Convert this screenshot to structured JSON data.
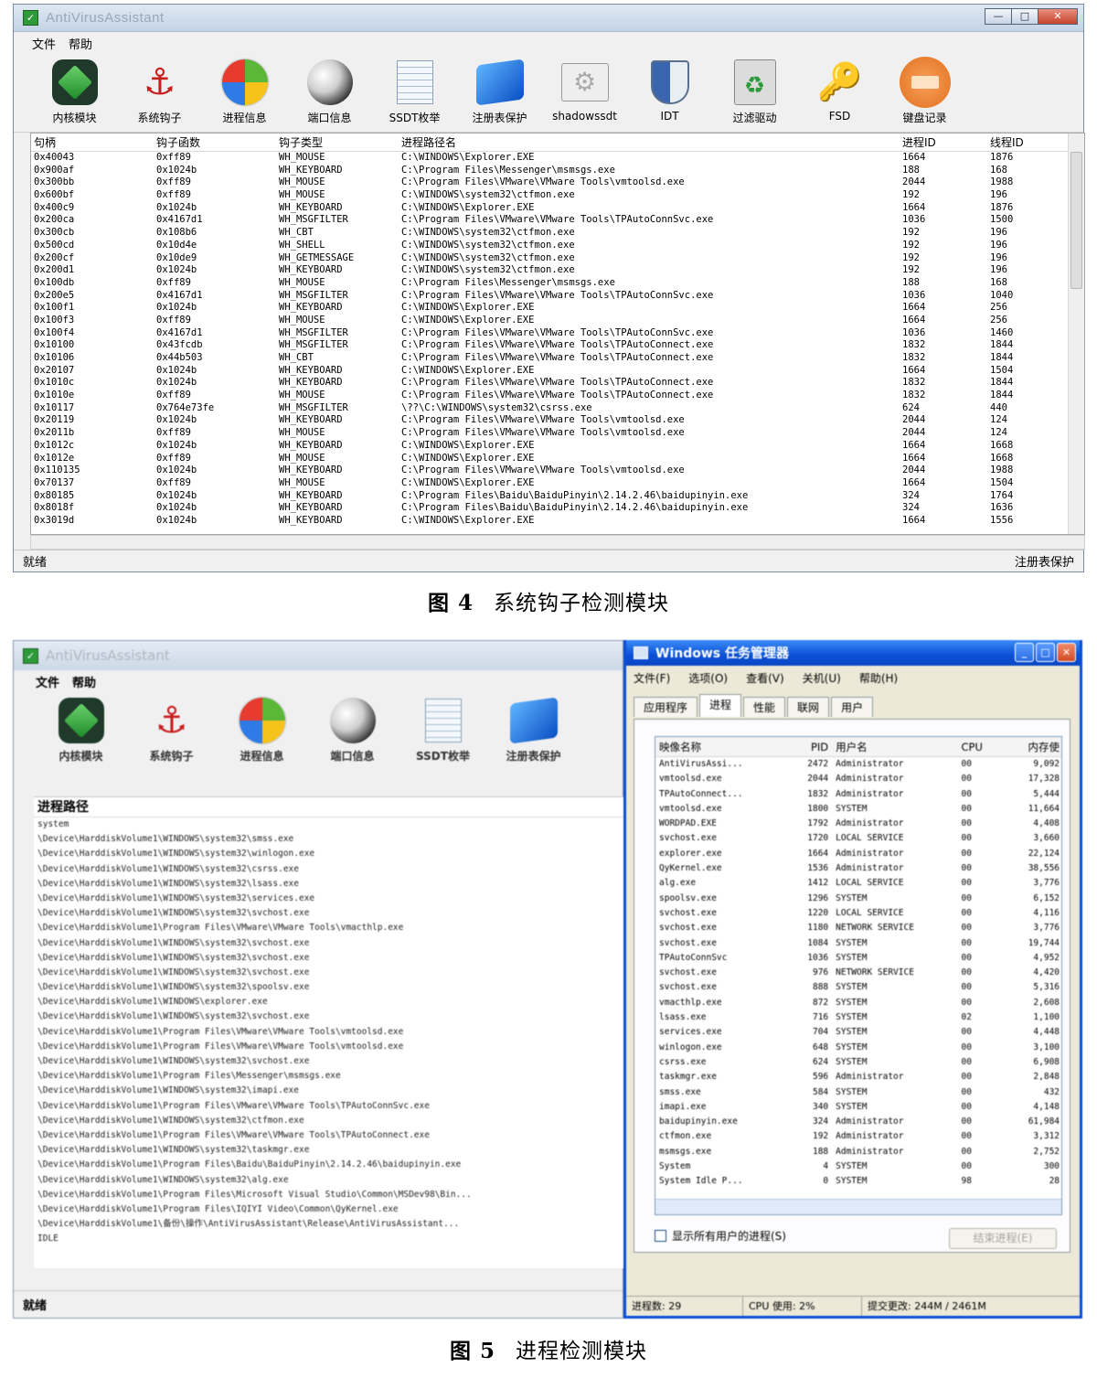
{
  "fig4": {
    "window_title": "AntiVirusAssistant",
    "menu": [
      "文件",
      "帮助"
    ],
    "toolbar": [
      {
        "label": "内核模块",
        "icon": "kernel-cube-icon"
      },
      {
        "label": "系统钩子",
        "icon": "anchor-icon"
      },
      {
        "label": "进程信息",
        "icon": "windows-logo-icon"
      },
      {
        "label": "端口信息",
        "icon": "globe-icon"
      },
      {
        "label": "SSDT枚举",
        "icon": "table-icon"
      },
      {
        "label": "注册表保护",
        "icon": "registry-icon"
      },
      {
        "label": "shadowssdt",
        "icon": "gear-window-icon"
      },
      {
        "label": "IDT",
        "icon": "shield-icon"
      },
      {
        "label": "过滤驱动",
        "icon": "recycle-icon"
      },
      {
        "label": "FSD",
        "icon": "key-icon"
      },
      {
        "label": "键盘记录",
        "icon": "keyboard-icon"
      }
    ],
    "columns": [
      "句柄",
      "钩子函数",
      "钩子类型",
      "进程路径名",
      "进程ID",
      "线程ID"
    ],
    "rows": [
      [
        "0x40043",
        "0xff89",
        "WH_MOUSE",
        "C:\\WINDOWS\\Explorer.EXE",
        "1664",
        "1876"
      ],
      [
        "0x900af",
        "0x1024b",
        "WH_KEYBOARD",
        "C:\\Program Files\\Messenger\\msmsgs.exe",
        "188",
        "168"
      ],
      [
        "0x300bb",
        "0xff89",
        "WH_MOUSE",
        "C:\\Program Files\\VMware\\VMware Tools\\vmtoolsd.exe",
        "2044",
        "1988"
      ],
      [
        "0x600bf",
        "0xff89",
        "WH_MOUSE",
        "C:\\WINDOWS\\system32\\ctfmon.exe",
        "192",
        "196"
      ],
      [
        "0x400c9",
        "0x1024b",
        "WH_KEYBOARD",
        "C:\\WINDOWS\\Explorer.EXE",
        "1664",
        "1876"
      ],
      [
        "0x200ca",
        "0x4167d1",
        "WH_MSGFILTER",
        "C:\\Program Files\\VMware\\VMware Tools\\TPAutoConnSvc.exe",
        "1036",
        "1500"
      ],
      [
        "0x300cb",
        "0x108b6",
        "WH_CBT",
        "C:\\WINDOWS\\system32\\ctfmon.exe",
        "192",
        "196"
      ],
      [
        "0x500cd",
        "0x10d4e",
        "WH_SHELL",
        "C:\\WINDOWS\\system32\\ctfmon.exe",
        "192",
        "196"
      ],
      [
        "0x200cf",
        "0x10de9",
        "WH_GETMESSAGE",
        "C:\\WINDOWS\\system32\\ctfmon.exe",
        "192",
        "196"
      ],
      [
        "0x200d1",
        "0x1024b",
        "WH_KEYBOARD",
        "C:\\WINDOWS\\system32\\ctfmon.exe",
        "192",
        "196"
      ],
      [
        "0x100db",
        "0xff89",
        "WH_MOUSE",
        "C:\\Program Files\\Messenger\\msmsgs.exe",
        "188",
        "168"
      ],
      [
        "0x200e5",
        "0x4167d1",
        "WH_MSGFILTER",
        "C:\\Program Files\\VMware\\VMware Tools\\TPAutoConnSvc.exe",
        "1036",
        "1040"
      ],
      [
        "0x100f1",
        "0x1024b",
        "WH_KEYBOARD",
        "C:\\WINDOWS\\Explorer.EXE",
        "1664",
        "256"
      ],
      [
        "0x100f3",
        "0xff89",
        "WH_MOUSE",
        "C:\\WINDOWS\\Explorer.EXE",
        "1664",
        "256"
      ],
      [
        "0x100f4",
        "0x4167d1",
        "WH_MSGFILTER",
        "C:\\Program Files\\VMware\\VMware Tools\\TPAutoConnSvc.exe",
        "1036",
        "1460"
      ],
      [
        "0x10100",
        "0x43fcdb",
        "WH_MSGFILTER",
        "C:\\Program Files\\VMware\\VMware Tools\\TPAutoConnect.exe",
        "1832",
        "1844"
      ],
      [
        "0x10106",
        "0x44b503",
        "WH_CBT",
        "C:\\Program Files\\VMware\\VMware Tools\\TPAutoConnect.exe",
        "1832",
        "1844"
      ],
      [
        "0x20107",
        "0x1024b",
        "WH_KEYBOARD",
        "C:\\WINDOWS\\Explorer.EXE",
        "1664",
        "1504"
      ],
      [
        "0x1010c",
        "0x1024b",
        "WH_KEYBOARD",
        "C:\\Program Files\\VMware\\VMware Tools\\TPAutoConnect.exe",
        "1832",
        "1844"
      ],
      [
        "0x1010e",
        "0xff89",
        "WH_MOUSE",
        "C:\\Program Files\\VMware\\VMware Tools\\TPAutoConnect.exe",
        "1832",
        "1844"
      ],
      [
        "0x10117",
        "0x764e73fe",
        "WH_MSGFILTER",
        "\\??\\C:\\WINDOWS\\system32\\csrss.exe",
        "624",
        "440"
      ],
      [
        "0x20119",
        "0x1024b",
        "WH_KEYBOARD",
        "C:\\Program Files\\VMware\\VMware Tools\\vmtoolsd.exe",
        "2044",
        "124"
      ],
      [
        "0x2011b",
        "0xff89",
        "WH_MOUSE",
        "C:\\Program Files\\VMware\\VMware Tools\\vmtoolsd.exe",
        "2044",
        "124"
      ],
      [
        "0x1012c",
        "0x1024b",
        "WH_KEYBOARD",
        "C:\\WINDOWS\\Explorer.EXE",
        "1664",
        "1668"
      ],
      [
        "0x1012e",
        "0xff89",
        "WH_MOUSE",
        "C:\\WINDOWS\\Explorer.EXE",
        "1664",
        "1668"
      ],
      [
        "0x110135",
        "0x1024b",
        "WH_KEYBOARD",
        "C:\\Program Files\\VMware\\VMware Tools\\vmtoolsd.exe",
        "2044",
        "1988"
      ],
      [
        "0x70137",
        "0xff89",
        "WH_MOUSE",
        "C:\\WINDOWS\\Explorer.EXE",
        "1664",
        "1504"
      ],
      [
        "0x80185",
        "0x1024b",
        "WH_KEYBOARD",
        "C:\\Program Files\\Baidu\\BaiduPinyin\\2.14.2.46\\baidupinyin.exe",
        "324",
        "1764"
      ],
      [
        "0x8018f",
        "0x1024b",
        "WH_KEYBOARD",
        "C:\\Program Files\\Baidu\\BaiduPinyin\\2.14.2.46\\baidupinyin.exe",
        "324",
        "1636"
      ],
      [
        "0x3019d",
        "0x1024b",
        "WH_KEYBOARD",
        "C:\\WINDOWS\\Explorer.EXE",
        "1664",
        "1556"
      ]
    ],
    "status_left": "就绪",
    "status_right": "注册表保护",
    "caption_num": "图 4",
    "caption_text": "系统钩子检测模块"
  },
  "fig5": {
    "left": {
      "window_title": "AntiVirusAssistant",
      "menu": [
        "文件",
        "帮助"
      ],
      "toolbar": [
        {
          "label": "内核模块",
          "icon": "kernel-cube-icon"
        },
        {
          "label": "系统钩子",
          "icon": "anchor-icon"
        },
        {
          "label": "进程信息",
          "icon": "windows-logo-icon"
        },
        {
          "label": "端口信息",
          "icon": "globe-icon"
        },
        {
          "label": "SSDT枚举",
          "icon": "table-icon"
        },
        {
          "label": "注册表保护",
          "icon": "registry-icon"
        }
      ],
      "list_header": "进程路径",
      "paths": [
        "system",
        "\\Device\\HarddiskVolume1\\WINDOWS\\system32\\smss.exe",
        "\\Device\\HarddiskVolume1\\WINDOWS\\system32\\winlogon.exe",
        "\\Device\\HarddiskVolume1\\WINDOWS\\system32\\csrss.exe",
        "\\Device\\HarddiskVolume1\\WINDOWS\\system32\\lsass.exe",
        "\\Device\\HarddiskVolume1\\WINDOWS\\system32\\services.exe",
        "\\Device\\HarddiskVolume1\\WINDOWS\\system32\\svchost.exe",
        "\\Device\\HarddiskVolume1\\Program Files\\VMware\\VMware Tools\\vmacthlp.exe",
        "\\Device\\HarddiskVolume1\\WINDOWS\\system32\\svchost.exe",
        "\\Device\\HarddiskVolume1\\WINDOWS\\system32\\svchost.exe",
        "\\Device\\HarddiskVolume1\\WINDOWS\\system32\\svchost.exe",
        "\\Device\\HarddiskVolume1\\WINDOWS\\system32\\spoolsv.exe",
        "\\Device\\HarddiskVolume1\\WINDOWS\\explorer.exe",
        "\\Device\\HarddiskVolume1\\WINDOWS\\system32\\svchost.exe",
        "\\Device\\HarddiskVolume1\\Program Files\\VMware\\VMware Tools\\vmtoolsd.exe",
        "\\Device\\HarddiskVolume1\\Program Files\\VMware\\VMware Tools\\vmtoolsd.exe",
        "\\Device\\HarddiskVolume1\\WINDOWS\\system32\\svchost.exe",
        "\\Device\\HarddiskVolume1\\Program Files\\Messenger\\msmsgs.exe",
        "\\Device\\HarddiskVolume1\\WINDOWS\\system32\\imapi.exe",
        "\\Device\\HarddiskVolume1\\Program Files\\VMware\\VMware Tools\\TPAutoConnSvc.exe",
        "\\Device\\HarddiskVolume1\\WINDOWS\\system32\\ctfmon.exe",
        "\\Device\\HarddiskVolume1\\Program Files\\VMware\\VMware Tools\\TPAutoConnect.exe",
        "\\Device\\HarddiskVolume1\\WINDOWS\\system32\\taskmgr.exe",
        "\\Device\\HarddiskVolume1\\Program Files\\Baidu\\BaiduPinyin\\2.14.2.46\\baidupinyin.exe",
        "\\Device\\HarddiskVolume1\\WINDOWS\\system32\\alg.exe",
        "\\Device\\HarddiskVolume1\\Program Files\\Microsoft Visual Studio\\Common\\MSDev98\\Bin...",
        "\\Device\\HarddiskVolume1\\Program Files\\IQIYI Video\\Common\\QyKernel.exe",
        "\\Device\\HarddiskVolume1\\备份\\操作\\AntiVirusAssistant\\Release\\AntiVirusAssistant...",
        "IDLE"
      ],
      "status": "就绪"
    },
    "right": {
      "window_title": "Windows 任务管理器",
      "menu": [
        "文件(F)",
        "选项(O)",
        "查看(V)",
        "关机(U)",
        "帮助(H)"
      ],
      "tabs": [
        "应用程序",
        "进程",
        "性能",
        "联网",
        "用户"
      ],
      "active_tab": "进程",
      "columns": [
        "映像名称",
        "PID",
        "用户名",
        "CPU",
        "内存使"
      ],
      "rows": [
        [
          "AntiVirusAssi...",
          "2472",
          "Administrator",
          "00",
          "9,092"
        ],
        [
          "vmtoolsd.exe",
          "2044",
          "Administrator",
          "00",
          "17,328"
        ],
        [
          "TPAutoConnect...",
          "1832",
          "Administrator",
          "00",
          "5,444"
        ],
        [
          "vmtoolsd.exe",
          "1800",
          "SYSTEM",
          "00",
          "11,664"
        ],
        [
          "WORDPAD.EXE",
          "1792",
          "Administrator",
          "00",
          "4,408"
        ],
        [
          "svchost.exe",
          "1720",
          "LOCAL SERVICE",
          "00",
          "3,660"
        ],
        [
          "explorer.exe",
          "1664",
          "Administrator",
          "00",
          "22,124"
        ],
        [
          "QyKernel.exe",
          "1536",
          "Administrator",
          "00",
          "38,556"
        ],
        [
          "alg.exe",
          "1412",
          "LOCAL SERVICE",
          "00",
          "3,776"
        ],
        [
          "spoolsv.exe",
          "1296",
          "SYSTEM",
          "00",
          "6,152"
        ],
        [
          "svchost.exe",
          "1220",
          "LOCAL SERVICE",
          "00",
          "4,116"
        ],
        [
          "svchost.exe",
          "1180",
          "NETWORK SERVICE",
          "00",
          "3,776"
        ],
        [
          "svchost.exe",
          "1084",
          "SYSTEM",
          "00",
          "19,744"
        ],
        [
          "TPAutoConnSvc",
          "1036",
          "SYSTEM",
          "00",
          "4,952"
        ],
        [
          "svchost.exe",
          "976",
          "NETWORK SERVICE",
          "00",
          "4,420"
        ],
        [
          "svchost.exe",
          "888",
          "SYSTEM",
          "00",
          "5,316"
        ],
        [
          "vmacthlp.exe",
          "872",
          "SYSTEM",
          "00",
          "2,608"
        ],
        [
          "lsass.exe",
          "716",
          "SYSTEM",
          "02",
          "1,100"
        ],
        [
          "services.exe",
          "704",
          "SYSTEM",
          "00",
          "4,448"
        ],
        [
          "winlogon.exe",
          "648",
          "SYSTEM",
          "00",
          "3,100"
        ],
        [
          "csrss.exe",
          "624",
          "SYSTEM",
          "00",
          "6,908"
        ],
        [
          "taskmgr.exe",
          "596",
          "Administrator",
          "00",
          "2,848"
        ],
        [
          "smss.exe",
          "584",
          "SYSTEM",
          "00",
          "432"
        ],
        [
          "imapi.exe",
          "340",
          "SYSTEM",
          "00",
          "4,148"
        ],
        [
          "baidupinyin.exe",
          "324",
          "Administrator",
          "00",
          "61,984"
        ],
        [
          "ctfmon.exe",
          "192",
          "Administrator",
          "00",
          "3,312"
        ],
        [
          "msmsgs.exe",
          "188",
          "Administrator",
          "00",
          "2,752"
        ],
        [
          "System",
          "4",
          "SYSTEM",
          "00",
          "300"
        ],
        [
          "System Idle P...",
          "0",
          "SYSTEM",
          "98",
          "28"
        ]
      ],
      "show_all_label": "显示所有用户的进程(S)",
      "end_process_label": "结束进程(E)",
      "status": [
        "进程数: 29",
        "CPU 使用: 2%",
        "提交更改: 244M / 2461M"
      ]
    },
    "caption_num": "图 5",
    "caption_text": "进程检测模块"
  }
}
